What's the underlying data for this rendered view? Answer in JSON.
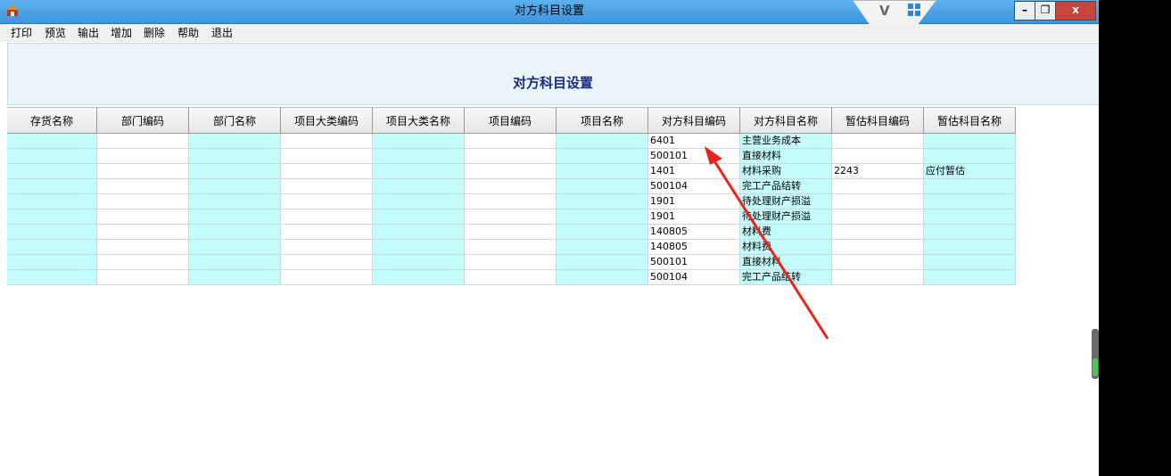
{
  "window": {
    "title": "对方科目设置",
    "controls": {
      "minimize": "–",
      "restore": "❐",
      "close": "x"
    },
    "logo": "V"
  },
  "menu": [
    "打印",
    "预览",
    "输出",
    "增加",
    "删除",
    "帮助",
    "退出"
  ],
  "report": {
    "title": "对方科目设置"
  },
  "grid": {
    "columns": [
      "存货名称",
      "部门编码",
      "部门名称",
      "项目大类编码",
      "项目大类名称",
      "项目编码",
      "项目名称",
      "对方科目编码",
      "对方科目名称",
      "暂估科目编码",
      "暂估科目名称"
    ],
    "rows": [
      [
        "",
        "",
        "",
        "",
        "",
        "",
        "",
        "6401",
        "主营业务成本",
        "",
        ""
      ],
      [
        "",
        "",
        "",
        "",
        "",
        "",
        "",
        "500101",
        "直接材料",
        "",
        ""
      ],
      [
        "",
        "",
        "",
        "",
        "",
        "",
        "",
        "1401",
        "材料采购",
        "2243",
        "应付暂估"
      ],
      [
        "",
        "",
        "",
        "",
        "",
        "",
        "",
        "500104",
        "完工产品结转",
        "",
        ""
      ],
      [
        "",
        "",
        "",
        "",
        "",
        "",
        "",
        "1901",
        "待处理财产损溢",
        "",
        ""
      ],
      [
        "",
        "",
        "",
        "",
        "",
        "",
        "",
        "1901",
        "待处理财产损溢",
        "",
        ""
      ],
      [
        "",
        "",
        "",
        "",
        "",
        "",
        "",
        "140805",
        "材料费",
        "",
        ""
      ],
      [
        "",
        "",
        "",
        "",
        "",
        "",
        "",
        "140805",
        "材料费",
        "",
        ""
      ],
      [
        "",
        "",
        "",
        "",
        "",
        "",
        "",
        "500101",
        "直接材料",
        "",
        ""
      ],
      [
        "",
        "",
        "",
        "",
        "",
        "",
        "",
        "500104",
        "完工产品结转",
        "",
        ""
      ]
    ]
  },
  "colors": {
    "cyan_cell": "#c4fbfb",
    "title_bar": "#3d95dd",
    "annotation": "#e8231c"
  },
  "icons": {
    "app": "app-icon",
    "grid": "grid-logo-icon"
  }
}
